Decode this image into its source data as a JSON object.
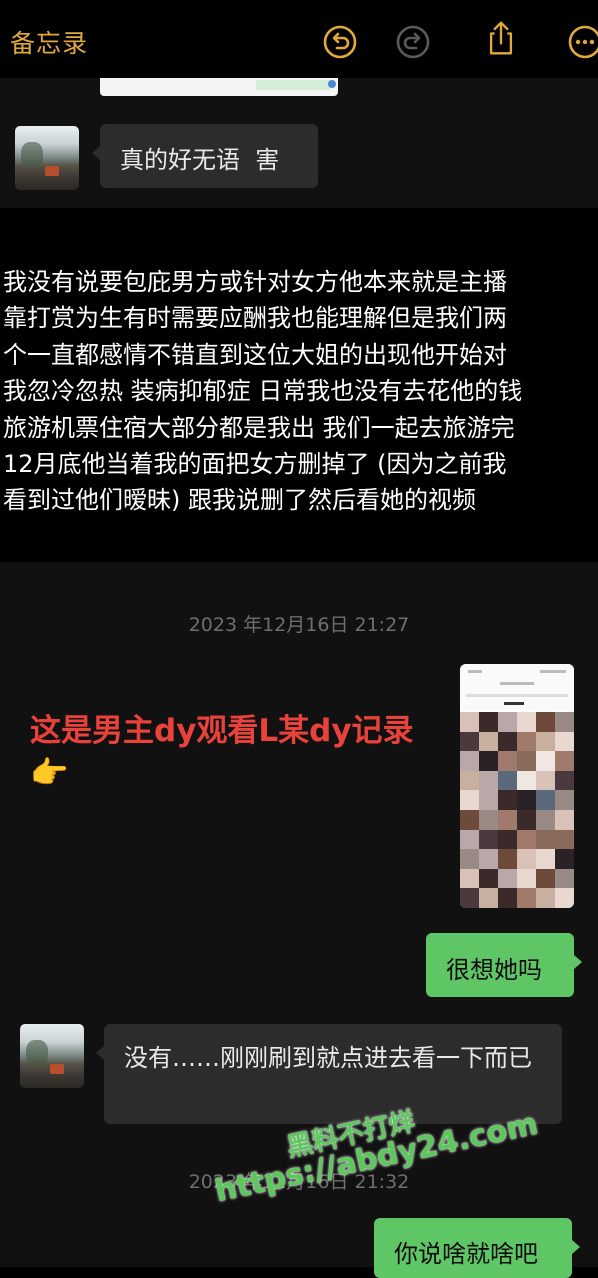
{
  "notes_bar": {
    "back_label": "备忘录",
    "icons": [
      "undo-icon",
      "redo-icon",
      "share-icon",
      "more-icon"
    ],
    "accent_color": "#e2a93a"
  },
  "chat_top": {
    "incoming_message": "真的好无语  害"
  },
  "note_lines": [
    "我没有说要包庇男方或针对女方他本来就是主播",
    "靠打赏为生有时需要应酬我也能理解但是我们两",
    "个一直都感情不错直到这位大姐的出现他开始对",
    "我忽冷忽热 装病抑郁症 日常我也没有去花他的钱",
    "旅游机票住宿大部分都是我出 我们一起去旅游完",
    "12月底他当着我的面把女方删掉了 (因为之前我",
    "看到过他们暧昧) 跟我说删了然后看她的视频"
  ],
  "chat_bottom": {
    "timestamp_1": "2023 年12月16日 21:27",
    "annotation": "这是男主dy观看L某dy记录👉",
    "annotation_color": "#e9423a",
    "outgoing_1": "很想她吗",
    "incoming_1": "没有……刚刚刷到就点进去看一下而已",
    "timestamp_2": "2023 年12月16日 21:32",
    "outgoing_2": "你说啥就啥吧"
  },
  "watermark": {
    "line1": "黑料不打烊",
    "line2": "https://abdy24.com",
    "color": "#5cc85c"
  }
}
